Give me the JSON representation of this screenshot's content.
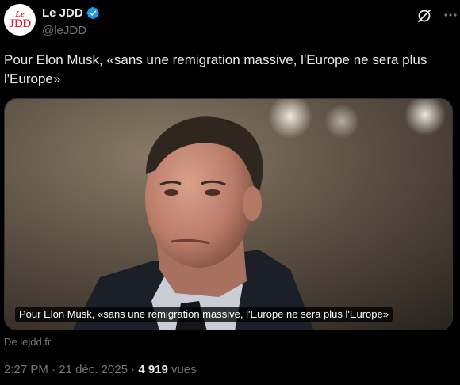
{
  "author": {
    "avatar_line1": "Le",
    "avatar_line2": "JDD",
    "display_name": "Le JDD",
    "handle": "@leJDD",
    "verified": true
  },
  "icons": {
    "verified": "verified-badge-icon",
    "grok": "grok-icon",
    "more": "more-options-icon"
  },
  "tweet": {
    "text": "Pour Elon Musk, «sans une remigration massive, l'Europe ne sera plus l'Europe»"
  },
  "card": {
    "image": "portrait of Elon Musk",
    "title": "Pour Elon Musk, «sans une remigration massive, l'Europe ne sera plus l'Europe»",
    "source": "De lejdd.fr"
  },
  "footer": {
    "time": "2:27 PM",
    "separator": " · ",
    "date": "21 déc. 2025",
    "views_count": "4 919",
    "views_label": " vues"
  },
  "colors": {
    "background": "#000000",
    "text": "#e7e9ea",
    "secondary": "#71767b",
    "verified": "#1d9bf0",
    "brand_red": "#d51f2e"
  }
}
